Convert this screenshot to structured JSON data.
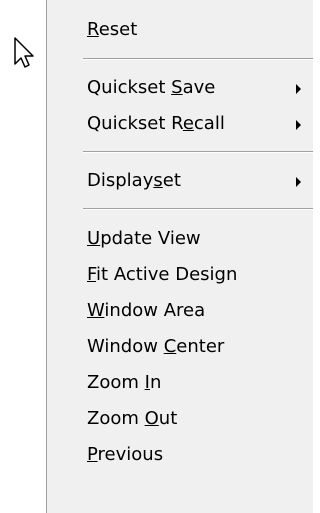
{
  "menu": {
    "reset": {
      "before": "",
      "key": "R",
      "after": "eset"
    },
    "quickset_save": {
      "before": "Quickset ",
      "key": "S",
      "after": "ave",
      "submenu": true
    },
    "quickset_recall": {
      "before": "Quickset R",
      "key": "e",
      "after": "call",
      "submenu": true
    },
    "displayset": {
      "before": "Display",
      "key": "s",
      "after": "et",
      "submenu": true
    },
    "update_view": {
      "before": "",
      "key": "U",
      "after": "pdate View"
    },
    "fit_active": {
      "before": "",
      "key": "F",
      "after": "it Active Design"
    },
    "window_area": {
      "before": "",
      "key": "W",
      "after": "indow Area"
    },
    "window_center": {
      "before": "Window ",
      "key": "C",
      "after": "enter"
    },
    "zoom_in": {
      "before": "Zoom ",
      "key": "I",
      "after": "n"
    },
    "zoom_out": {
      "before": "Zoom ",
      "key": "O",
      "after": "ut"
    },
    "previous": {
      "before": "",
      "key": "P",
      "after": "revious"
    }
  },
  "icons": {
    "cursor": "mouse-pointer-arrow",
    "submenu": "submenu-arrow"
  },
  "colors": {
    "menu_background": "#f0f0f0",
    "text": "#000000",
    "separator": "#a0a0a0"
  }
}
